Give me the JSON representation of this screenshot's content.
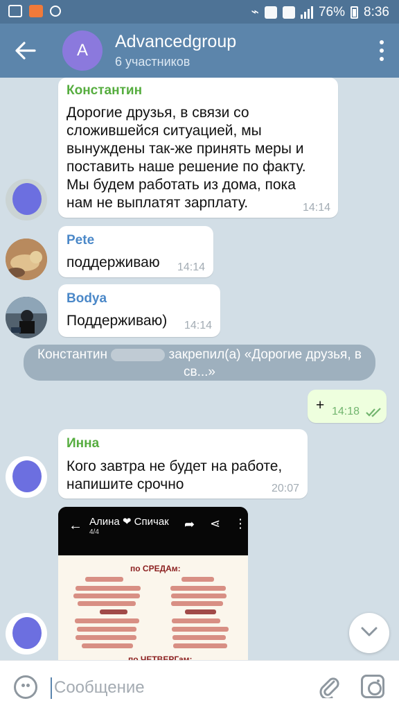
{
  "status_bar": {
    "battery_percent": "76%",
    "time": "8:36"
  },
  "header": {
    "avatar_letter": "A",
    "title": "Advancedgroup",
    "subtitle": "6 участников"
  },
  "messages": [
    {
      "sender": "Константин",
      "text": "Дорогие друзья, в связи со\nсложившейся ситуацией, мы\nвынуждены так-же принять меры и\nпоставить наше решение по факту.\nМы будем работать из дома, пока\nнам не выплатят зарплату.",
      "time": "14:14"
    },
    {
      "sender": "Pete",
      "text": "поддерживаю",
      "time": "14:14"
    },
    {
      "sender": "Bodya",
      "text": "Поддерживаю)",
      "time": "14:14"
    },
    {
      "system": "Константин",
      "system_tail": "закрепил(а) «Дорогие друзья, в св...»"
    },
    {
      "text": "+",
      "time": "14:18"
    },
    {
      "sender": "Инна",
      "text": "Кого завтра не будет на работе,\nнапишите срочно",
      "time": "20:07"
    }
  ],
  "image_preview": {
    "author": "Алина ❤ Спичак",
    "count": "4/4",
    "heading1": "по СРЕДАм:",
    "heading2": "по ЧЕТВЕРГам:"
  },
  "input": {
    "placeholder": "Сообщение"
  },
  "colors": {
    "header": "#5c85ab",
    "sender_green": "#56ad3f",
    "sender_blue": "#4b88c8",
    "outgoing": "#eeffde"
  }
}
